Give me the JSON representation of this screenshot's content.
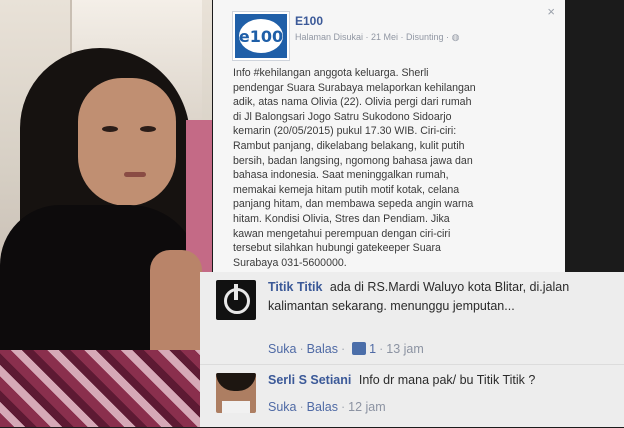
{
  "post": {
    "page_name": "E100",
    "page_logo_text": "e100",
    "meta": "Halaman Disukai · 21 Mei · Disunting · ",
    "close_glyph": "×",
    "text": "Info #kehilangan anggota keluarga. Sherli\npendengar Suara Surabaya melaporkan kehilangan\nadik, atas nama Olivia (22). Olivia pergi dari rumah\ndi Jl Balongsari Jogo Satru Sukodono Sidoarjo\nkemarin (20/05/2015) pukul 17.30 WIB. Ciri-ciri:\nRambut panjang, dikelabang belakang, kulit putih\nbersih, badan langsing, ngomong bahasa jawa dan\nbahasa indonesia. Saat meninggalkan rumah,\nmemakai kemeja hitam putih motif kotak, celana\npanjang hitam, dan membawa sepeda angin warna\nhitam. Kondisi Olivia, Stres dan Pendiam. Jika\nkawan mengetahui perempuan dengan ciri-ciri\ntersebut silahkan hubungi gatekeeper Suara\nSurabaya 031-5600000.\nFoto: Sherli via Redaksi Suara Surabaya (odp-pr) —"
  },
  "comments": [
    {
      "name": "Titik Titik",
      "text": "ada di RS.Mardi Waluyo kota Blitar, di.jalan kalimantan sekarang. menunggu jemputan...",
      "like_label": "Suka",
      "reply_label": "Balas",
      "like_count": "1",
      "time": "13 jam"
    },
    {
      "name": "Serli S Setiani",
      "text": "Info dr mana pak/ bu Titik Titik ?",
      "like_label": "Suka",
      "reply_label": "Balas",
      "time": "12 jam"
    }
  ],
  "colors": {
    "link": "#3b5998",
    "meta": "#9197a3",
    "card_bg": "#f6f6f6",
    "comments_bg": "#ededed"
  }
}
